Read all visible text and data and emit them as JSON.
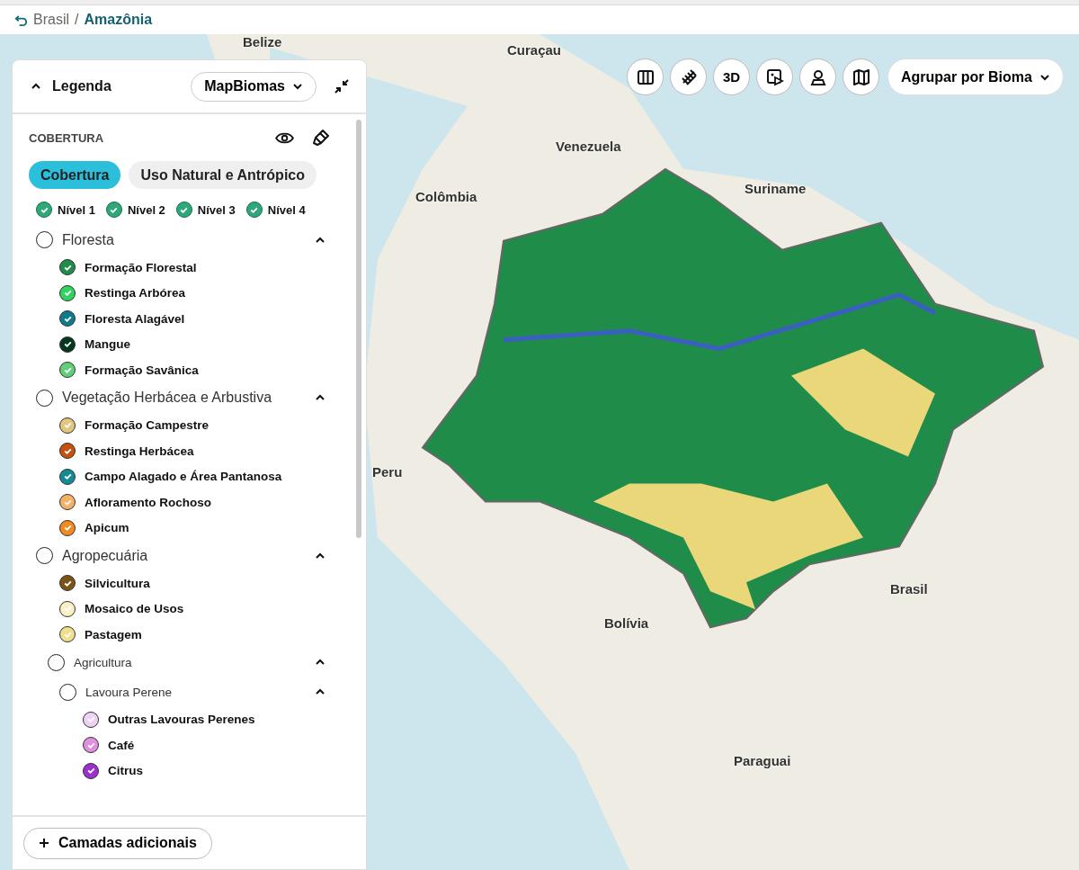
{
  "breadcrumb": {
    "parent": "Brasil",
    "current": "Amazônia"
  },
  "breadcrumb_separator": "/",
  "map_labels": [
    "Belize",
    "Curaçau",
    "Venezuela",
    "Colômbia",
    "Suriname",
    "Peru",
    "Brasil",
    "Bolívia",
    "Paraguai"
  ],
  "toolbar": {
    "buttons": [
      {
        "kind": "columns"
      },
      {
        "kind": "rail"
      },
      {
        "kind": "text",
        "label": "3D"
      },
      {
        "kind": "media"
      },
      {
        "kind": "pin"
      },
      {
        "kind": "map"
      }
    ],
    "group_by": "Agrupar por Bioma"
  },
  "legend": {
    "title": "Legenda",
    "source": "MapBiomas",
    "section": "COBERTURA",
    "tabs": [
      {
        "label": "Cobertura",
        "selected": true
      },
      {
        "label": "Uso Natural e Antrópico",
        "selected": false
      }
    ],
    "levels": [
      {
        "label": "Nível 1",
        "checked": true
      },
      {
        "label": "Nível 2",
        "checked": true
      },
      {
        "label": "Nível 3",
        "checked": true
      },
      {
        "label": "Nível 4",
        "checked": true
      }
    ],
    "groups": [
      {
        "label": "Floresta",
        "checked": false,
        "expanded": true,
        "children": [
          {
            "label": "Formação Florestal",
            "checked": true,
            "color": "#1f8d49"
          },
          {
            "label": "Restinga Arbórea",
            "checked": true,
            "color": "#2fd35e"
          },
          {
            "label": "Floresta Alagável",
            "checked": true,
            "color": "#0f7a8a"
          },
          {
            "label": "Mangue",
            "checked": true,
            "color": "#04381d"
          },
          {
            "label": "Formação Savânica",
            "checked": true,
            "color": "#5fcf7a"
          }
        ]
      },
      {
        "label": "Vegetação Herbácea e Arbustiva",
        "checked": false,
        "expanded": true,
        "children": [
          {
            "label": "Formação Campestre",
            "checked": true,
            "color": "#e2c57e"
          },
          {
            "label": "Restinga Herbácea",
            "checked": true,
            "color": "#c4510f"
          },
          {
            "label": "Campo Alagado e Área Pantanosa",
            "checked": true,
            "color": "#138a94"
          },
          {
            "label": "Afloramento Rochoso",
            "checked": true,
            "color": "#f5b063"
          },
          {
            "label": "Apicum",
            "checked": true,
            "color": "#f28a1c"
          }
        ]
      },
      {
        "label": "Agropecuária",
        "checked": false,
        "expanded": true,
        "children": [
          {
            "label": "Silvicultura",
            "checked": true,
            "color": "#7a5417"
          },
          {
            "label": "Mosaico de Usos",
            "checked": true,
            "color": "#fbefc4"
          },
          {
            "label": "Pastagem",
            "checked": true,
            "color": "#f0e08e"
          },
          {
            "label": "Agricultura",
            "checked": false,
            "expanded": true,
            "children": [
              {
                "label": "Lavoura Perene",
                "checked": false,
                "expanded": true,
                "children": [
                  {
                    "label": "Outras Lavouras Perenes",
                    "checked": true,
                    "color": "#ecd3f5"
                  },
                  {
                    "label": "Café",
                    "checked": true,
                    "color": "#e08fe0"
                  },
                  {
                    "label": "Citrus",
                    "checked": true,
                    "color": "#9b2fd0"
                  }
                ]
              }
            ]
          }
        ]
      }
    ],
    "add_button": "Camadas adicionais"
  }
}
